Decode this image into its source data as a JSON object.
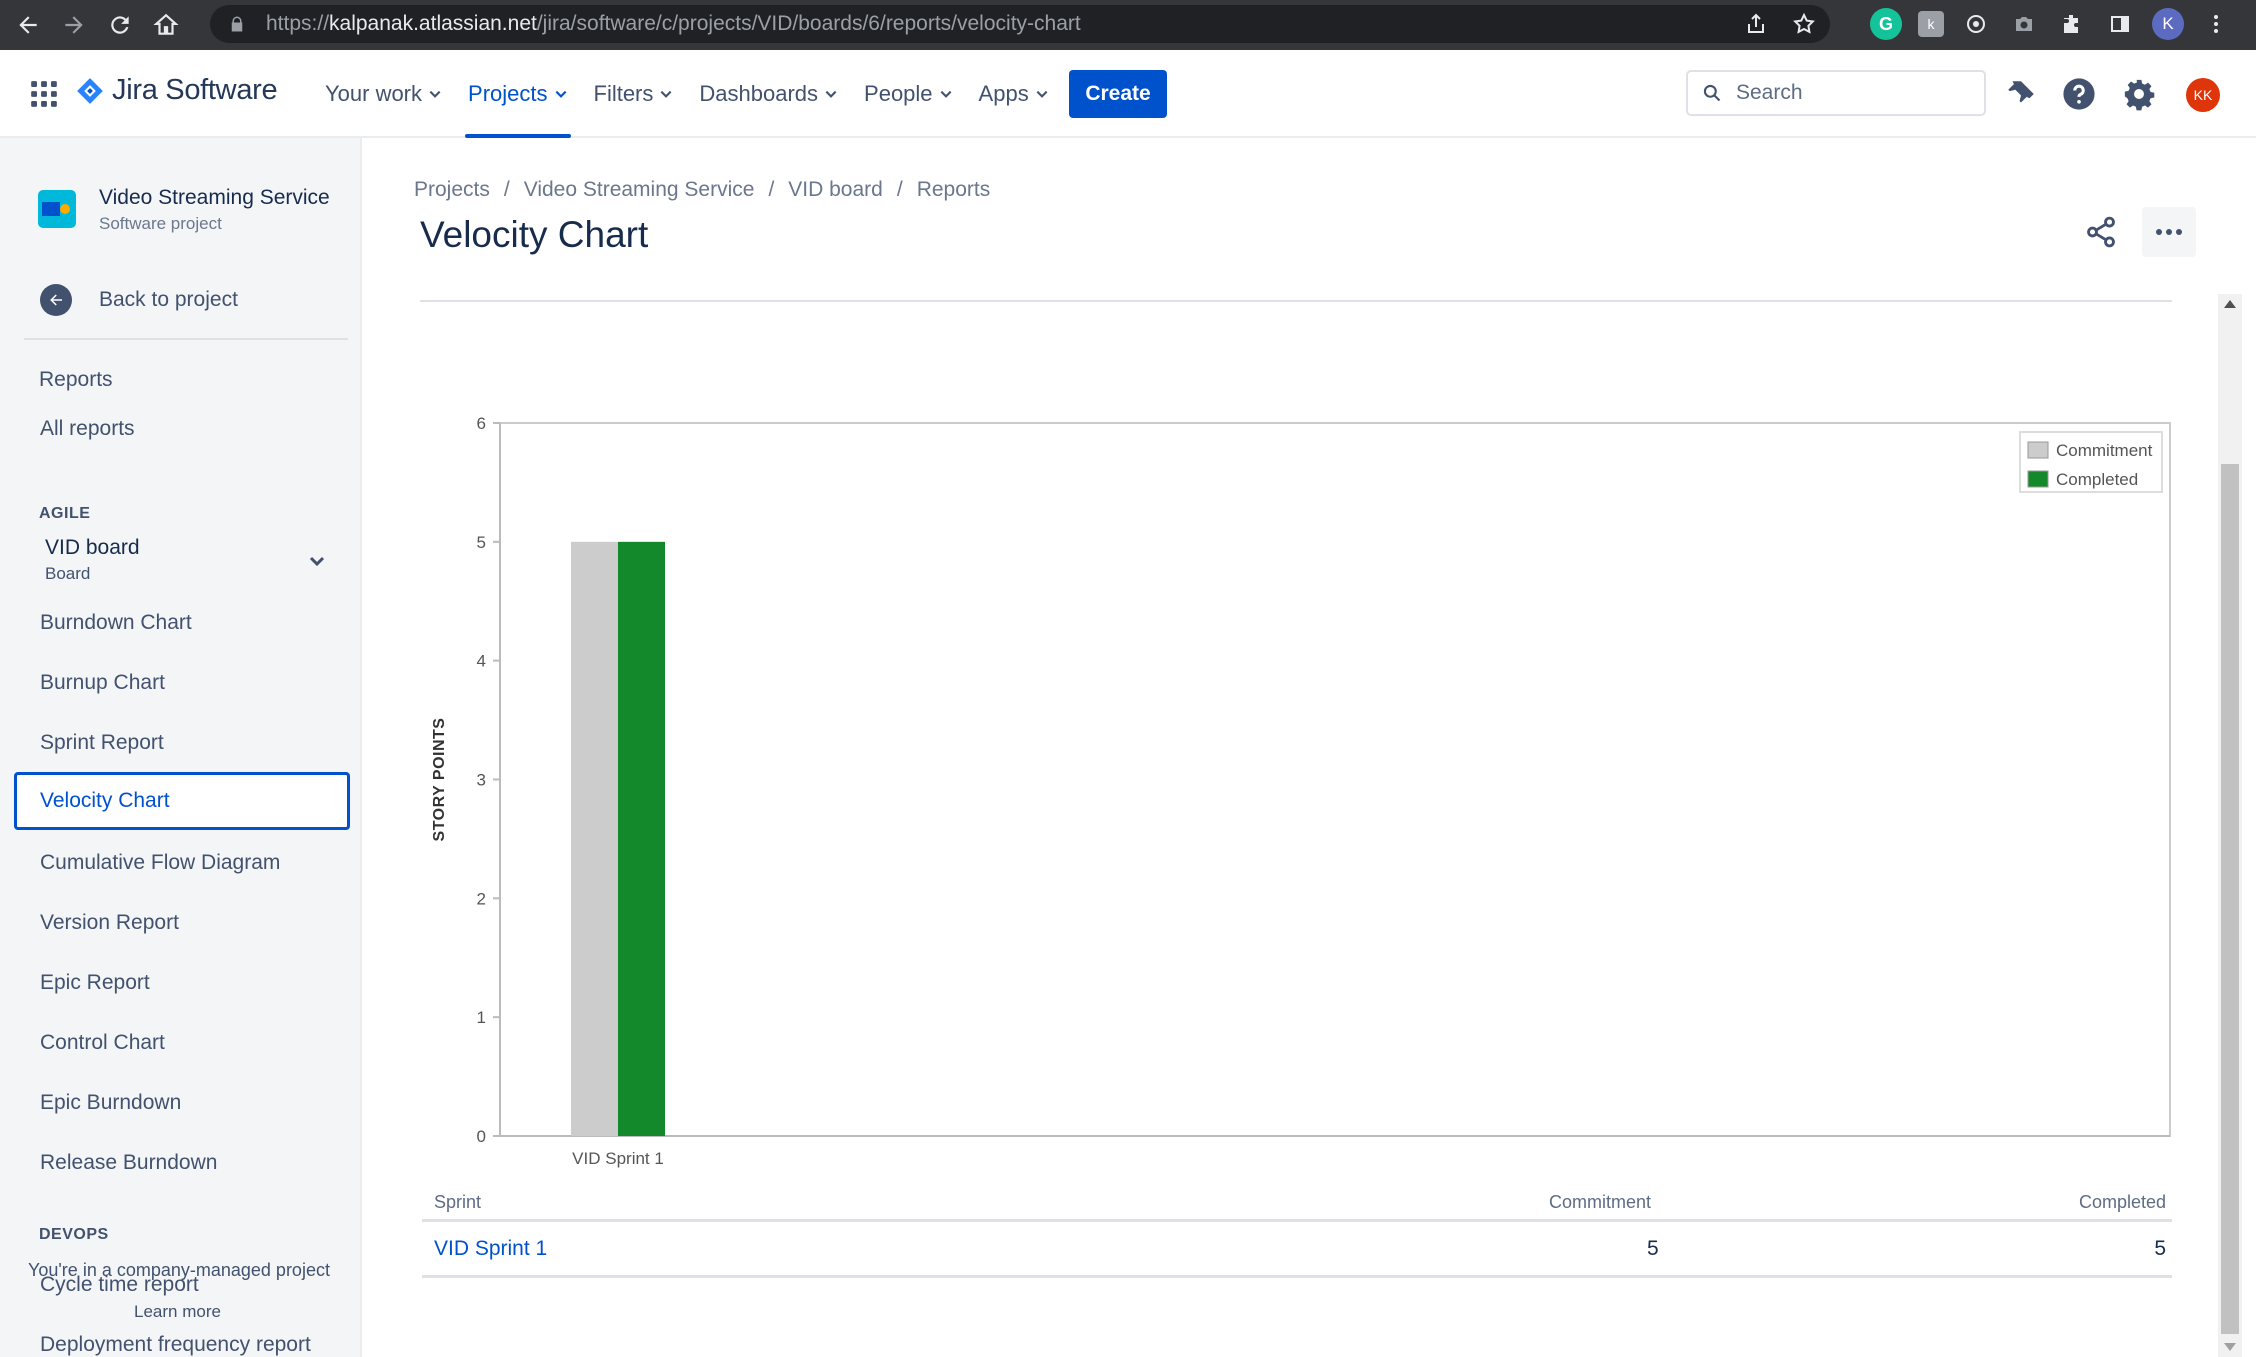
{
  "browser": {
    "url_prefix": "https://",
    "url_host": "kalpanak.atlassian.net",
    "url_path": "/jira/software/c/projects/VID/boards/6/reports/velocity-chart",
    "profile_initial": "K",
    "icons": [
      "back-icon",
      "forward-icon",
      "reload-icon",
      "home-icon",
      "lock-icon",
      "share-icon",
      "star-icon",
      "grammarly-icon",
      "extension-icon",
      "puzzle-icon",
      "sidepanel-icon",
      "kebab-icon"
    ]
  },
  "topnav": {
    "product": "Jira Software",
    "menu": [
      {
        "label": "Your work",
        "active": false
      },
      {
        "label": "Projects",
        "active": true
      },
      {
        "label": "Filters",
        "active": false
      },
      {
        "label": "Dashboards",
        "active": false
      },
      {
        "label": "People",
        "active": false
      },
      {
        "label": "Apps",
        "active": false
      }
    ],
    "create_label": "Create",
    "search_placeholder": "Search",
    "user_initials": "KK"
  },
  "sidebar": {
    "project_name": "Video Streaming Service",
    "project_type": "Software project",
    "back_label": "Back to project",
    "reports_title": "Reports",
    "all_reports": "All reports",
    "agile_label": "AGILE",
    "board_name": "VID board",
    "board_type": "Board",
    "items": [
      {
        "label": "Burndown Chart",
        "active": false
      },
      {
        "label": "Burnup Chart",
        "active": false
      },
      {
        "label": "Sprint Report",
        "active": false
      },
      {
        "label": "Velocity Chart",
        "active": true
      },
      {
        "label": "Cumulative Flow Diagram",
        "active": false
      },
      {
        "label": "Version Report",
        "active": false
      },
      {
        "label": "Epic Report",
        "active": false
      },
      {
        "label": "Control Chart",
        "active": false
      },
      {
        "label": "Epic Burndown",
        "active": false
      },
      {
        "label": "Release Burndown",
        "active": false
      }
    ],
    "devops_label": "DEVOPS",
    "devops_items": [
      "Cycle time report",
      "Deployment frequency report"
    ],
    "footnote": "You're in a company-managed project",
    "learn_more": "Learn more"
  },
  "main": {
    "breadcrumbs": [
      "Projects",
      "Video Streaming Service",
      "VID board",
      "Reports"
    ],
    "title": "Velocity Chart"
  },
  "chart_data": {
    "type": "bar",
    "categories": [
      "VID Sprint 1"
    ],
    "series": [
      {
        "name": "Commitment",
        "values": [
          5
        ],
        "color": "#cccccc"
      },
      {
        "name": "Completed",
        "values": [
          5
        ],
        "color": "#14892c"
      }
    ],
    "xlabel": "",
    "ylabel": "STORY POINTS",
    "ylim": [
      0,
      6
    ],
    "yticks": [
      0,
      1,
      2,
      3,
      4,
      5,
      6
    ],
    "legend": "top-right",
    "grid": false
  },
  "table": {
    "headers": [
      "Sprint",
      "Commitment",
      "Completed"
    ],
    "rows": [
      {
        "sprint": "VID Sprint 1",
        "commitment": "5",
        "completed": "5"
      }
    ]
  }
}
